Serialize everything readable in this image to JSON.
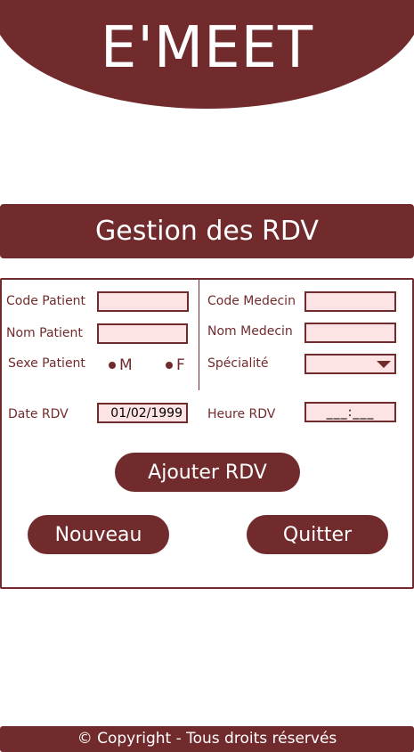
{
  "header": {
    "app_title": "E'MEET"
  },
  "section": {
    "title": "Gestion des RDV"
  },
  "form": {
    "code_patient_label": "Code Patient",
    "code_patient_value": "",
    "nom_patient_label": "Nom Patient",
    "nom_patient_value": "",
    "sexe_patient_label": "Sexe Patient",
    "sexe_options": [
      "M",
      "F"
    ],
    "code_medecin_label": "Code Medecin",
    "code_medecin_value": "",
    "nom_medecin_label": "Nom Medecin",
    "nom_medecin_value": "",
    "specialite_label": "Spécialité",
    "specialite_value": "",
    "date_rdv_label": "Date RDV",
    "date_rdv_value": "01/02/1999",
    "heure_rdv_label": "Heure RDV",
    "heure_rdv_value": "___:___"
  },
  "actions": {
    "ajouter_label": "Ajouter RDV",
    "nouveau_label": "Nouveau",
    "quitter_label": "Quitter"
  },
  "footer": {
    "copyright": "© Copyright - Tous droits réservés"
  },
  "colors": {
    "accent": "#722b2d",
    "field_bg": "#fde3e3",
    "text_on_accent": "#ffffff"
  }
}
